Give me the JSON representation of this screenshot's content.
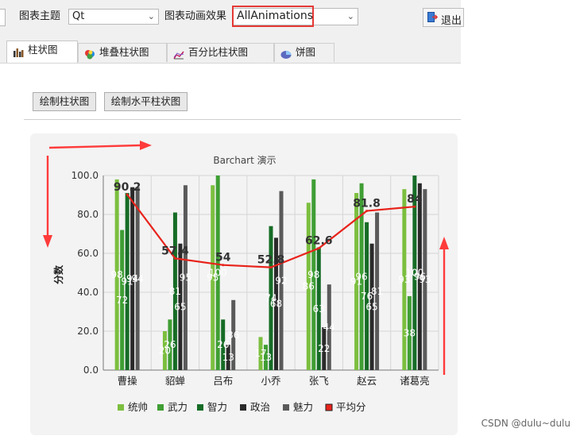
{
  "toolbar": {
    "theme_label": "图表主题",
    "theme_value": "Qt",
    "anim_label": "图表动画效果",
    "anim_value": "AllAnimations",
    "exit_label": "退出"
  },
  "tabs": [
    {
      "label": "柱状图",
      "icon": "bar-chart-icon",
      "active": true
    },
    {
      "label": "堆叠柱状图",
      "icon": "stacked-bar-icon",
      "active": false
    },
    {
      "label": "百分比柱状图",
      "icon": "percent-bar-icon",
      "active": false
    },
    {
      "label": "饼图",
      "icon": "pie-chart-icon",
      "active": false
    }
  ],
  "buttons": {
    "draw_bar": "绘制柱状图",
    "draw_hbar": "绘制水平柱状图"
  },
  "credit": "CSDN @dulu~dulu",
  "colors": {
    "highlight_border": "#e53935",
    "arrow": "#ff3b3b",
    "avg_line": "#e8231b"
  },
  "chart_data": {
    "type": "bar",
    "title": "Barchart 演示",
    "ylabel": "分数",
    "ylim": [
      0,
      100
    ],
    "yticks": [
      "0.0",
      "20.0",
      "40.0",
      "60.0",
      "80.0",
      "100.0"
    ],
    "categories": [
      "曹操",
      "貂蝉",
      "吕布",
      "小乔",
      "张飞",
      "赵云",
      "诸葛亮"
    ],
    "series": [
      {
        "name": "统帅",
        "color": "#7cbf3f",
        "values": [
          98,
          20,
          95,
          17,
          86,
          91,
          93
        ]
      },
      {
        "name": "武力",
        "color": "#3f9e34",
        "values": [
          72,
          26,
          100,
          13,
          98,
          96,
          38
        ]
      },
      {
        "name": "智力",
        "color": "#166c26",
        "values": [
          91,
          81,
          26,
          74,
          63,
          76,
          100
        ]
      },
      {
        "name": "政治",
        "color": "#2a2a2a",
        "values": [
          94,
          65,
          13,
          68,
          22,
          65,
          96
        ]
      },
      {
        "name": "魅力",
        "color": "#5a5a5a",
        "values": [
          94,
          95,
          36,
          92,
          44,
          81,
          93
        ]
      }
    ],
    "line": {
      "name": "平均分",
      "color": "#e8231b",
      "values": [
        90.2,
        57.4,
        54,
        52.8,
        62.6,
        81.8,
        84
      ]
    },
    "line_labels": [
      "90.2",
      "57.4",
      "54",
      "52.8",
      "62.6",
      "81.8",
      "84"
    ],
    "bar_labels": [
      [
        "98",
        "72",
        "91",
        "94",
        "94"
      ],
      [
        "20",
        "26",
        "81",
        "65",
        "95"
      ],
      [
        "95",
        "100",
        "26",
        "13",
        "36"
      ],
      [
        "17",
        "13",
        "74",
        "68",
        "92"
      ],
      [
        "86",
        "98",
        "63",
        "22",
        "44"
      ],
      [
        "91",
        "96",
        "76",
        "65",
        "81"
      ],
      [
        "93",
        "38",
        "100",
        "96",
        "93"
      ]
    ],
    "legend_position": "bottom",
    "grid": true
  }
}
